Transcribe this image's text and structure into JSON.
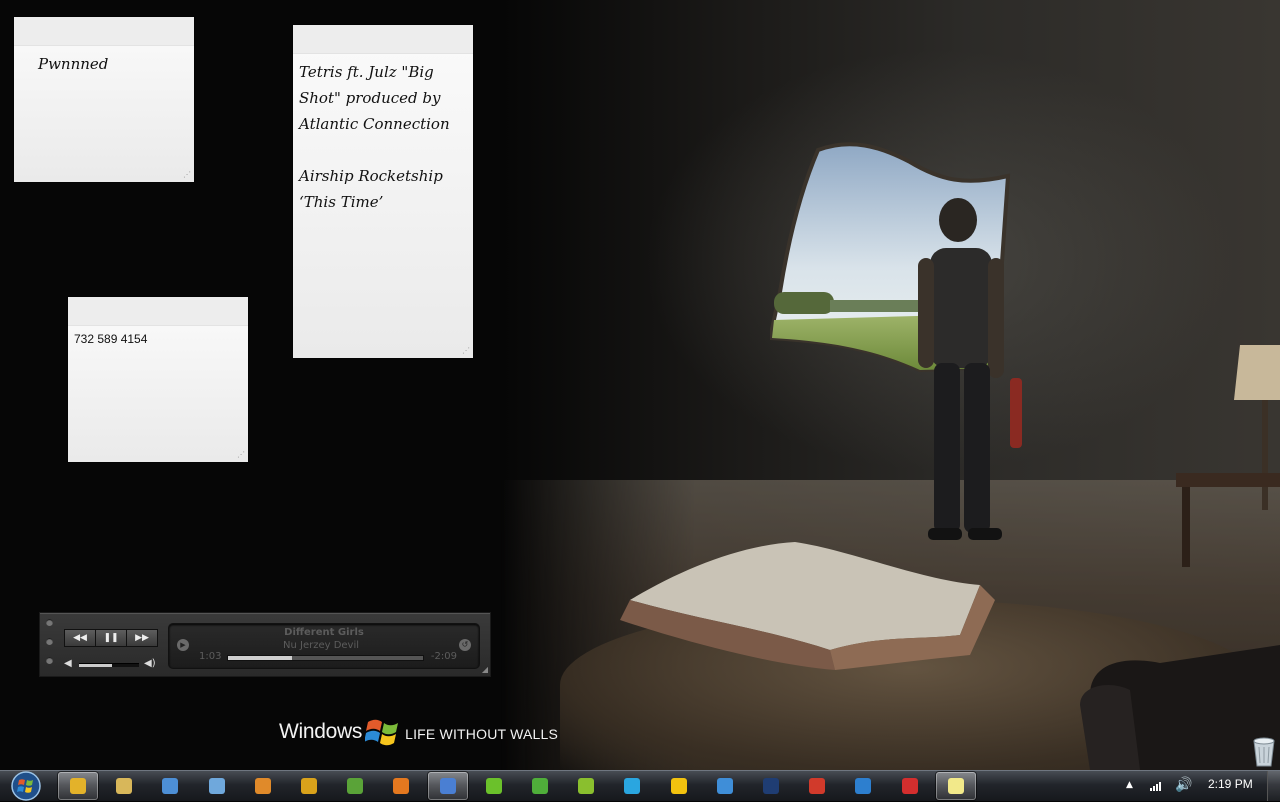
{
  "desktop": {
    "windows_logo": {
      "word": "Windows",
      "tagline": "LIFE WITHOUT WALLS"
    }
  },
  "notes": [
    {
      "text": "Pwnnned"
    },
    {
      "text": "Tetris ft. Julz \"Big Shot\" produced by Atlantic Connection\n\nAirship Rocketship\n‘This Time’"
    },
    {
      "text": "732 589 4154"
    }
  ],
  "media_player": {
    "track_title": "Different Girls",
    "artist": "Nu Jerzey Devil",
    "elapsed": "1:03",
    "remaining": "-2:09",
    "progress": 0.33,
    "volume": 0.55,
    "controls": {
      "rewind": "◀◀",
      "pause": "❚❚",
      "forward": "▶▶"
    }
  },
  "taskbar": {
    "pinned": [
      {
        "icon": "chrome-icon",
        "color": "#e3b22a",
        "active": true
      },
      {
        "icon": "folder-icon",
        "color": "#d8b75a",
        "active": false
      },
      {
        "icon": "control-panel-icon",
        "color": "#4d8fd6",
        "active": false
      },
      {
        "icon": "network-icon",
        "color": "#6fa8dc",
        "active": false
      },
      {
        "icon": "paint-icon",
        "color": "#e08a2a",
        "active": false
      },
      {
        "icon": "browser-wheel-icon",
        "color": "#d9a21b",
        "active": false
      },
      {
        "icon": "green-app-icon",
        "color": "#5aa338",
        "active": false
      },
      {
        "icon": "media-player-icon",
        "color": "#e4781f",
        "active": false
      },
      {
        "icon": "itunes-icon",
        "color": "#4a7fd3",
        "active": true
      },
      {
        "icon": "green-circle-icon",
        "color": "#6bc12b",
        "active": false
      },
      {
        "icon": "utorrent-icon",
        "color": "#4fae3a",
        "active": false
      },
      {
        "icon": "h-app-icon",
        "color": "#8abf2e",
        "active": false
      },
      {
        "icon": "skype-icon",
        "color": "#2aa6e0",
        "active": false
      },
      {
        "icon": "aim-icon",
        "color": "#f2c20f",
        "active": false
      },
      {
        "icon": "messenger-icon",
        "color": "#3f8ed8",
        "active": false
      },
      {
        "icon": "photoshop-icon",
        "color": "#1f3d73",
        "active": false
      },
      {
        "icon": "red-app-icon",
        "color": "#d13a2b",
        "active": false
      },
      {
        "icon": "teamviewer-icon",
        "color": "#2d7fcf",
        "active": false
      },
      {
        "icon": "x-app-icon",
        "color": "#d42e2e",
        "active": false
      },
      {
        "icon": "sticky-notes-icon",
        "color": "#f2e98a",
        "active": true
      }
    ],
    "tray": {
      "clock": "2:19 PM",
      "show_hidden": "▲",
      "volume_icon": "🔊"
    }
  },
  "colors": {
    "taskbar": "#23262c",
    "note": "#f4f4f4",
    "player": "#2f2f2f"
  }
}
